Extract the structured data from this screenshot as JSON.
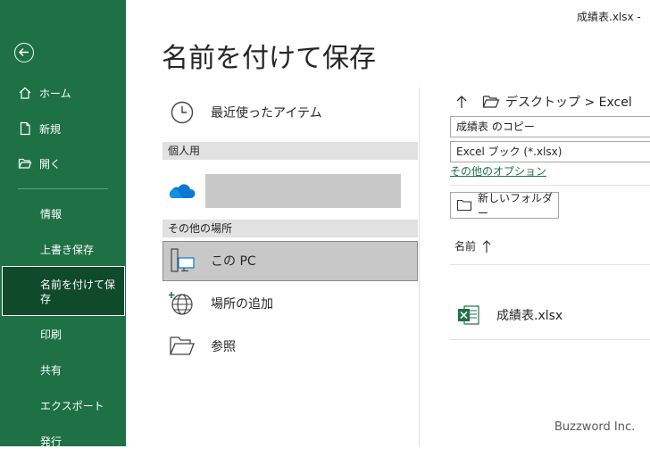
{
  "window": {
    "title": "成績表.xlsx  -"
  },
  "sidebar": {
    "items": [
      {
        "label": "ホーム",
        "icon": "home-icon"
      },
      {
        "label": "新規",
        "icon": "new-document-icon"
      },
      {
        "label": "開く",
        "icon": "open-folder-icon"
      },
      {
        "label": "情報"
      },
      {
        "label": "上書き保存"
      },
      {
        "label": "名前を付けて保存",
        "active": true
      },
      {
        "label": "印刷"
      },
      {
        "label": "共有"
      },
      {
        "label": "エクスポート"
      },
      {
        "label": "発行"
      }
    ],
    "accent": "#1e7145",
    "active_bg": "#0f4a2a"
  },
  "page": {
    "title": "名前を付けて保存"
  },
  "locations": {
    "recent_label": "最近使ったアイテム",
    "personal_header": "個人用",
    "other_header": "その他の場所",
    "this_pc_label": "この PC",
    "add_place_label": "場所の追加",
    "browse_label": "参照"
  },
  "save_panel": {
    "path": "デスクトップ > Excel",
    "filename_value": "成績表 のコピー",
    "filetype_value": "Excel ブック (*.xlsx)",
    "more_options_link": "その他のオプション",
    "new_folder_label": "新しいフォルダー",
    "column_name": "名前",
    "files": [
      {
        "name": "成績表.xlsx",
        "icon": "excel-file-icon"
      }
    ]
  },
  "watermark": "Buzzword Inc."
}
